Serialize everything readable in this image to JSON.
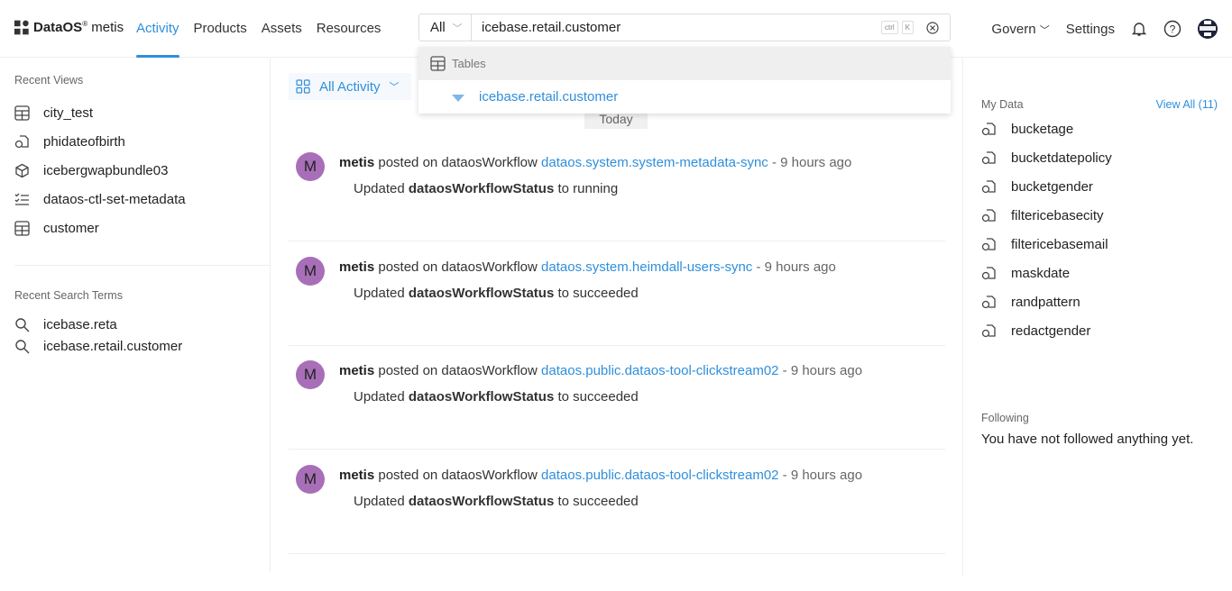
{
  "header": {
    "logo_brand": "DataOS",
    "logo_product": "metis",
    "nav": [
      {
        "label": "Activity",
        "active": true
      },
      {
        "label": "Products"
      },
      {
        "label": "Assets"
      },
      {
        "label": "Resources"
      }
    ],
    "search": {
      "scope": "All",
      "value": "icebase.retail.customer",
      "shortcut": [
        "ctrl",
        "K"
      ]
    },
    "right": {
      "govern": "Govern",
      "settings": "Settings"
    }
  },
  "dropdown": {
    "group": "Tables",
    "items": [
      {
        "label": "icebase.retail.customer"
      }
    ]
  },
  "sidebar": {
    "recent_views_title": "Recent Views",
    "recent_views": [
      {
        "label": "city_test",
        "icon": "table-icon"
      },
      {
        "label": "phidateofbirth",
        "icon": "policy-icon"
      },
      {
        "label": "icebergwapbundle03",
        "icon": "cube-icon"
      },
      {
        "label": "dataos-ctl-set-metadata",
        "icon": "checklist-icon"
      },
      {
        "label": "customer",
        "icon": "table-icon"
      }
    ],
    "recent_search_title": "Recent Search Terms",
    "recent_searches": [
      "icebase.reta",
      "icebase.retail.customer"
    ]
  },
  "main": {
    "filter": "All Activity",
    "day": "Today",
    "activities": [
      {
        "avatar": "M",
        "user": "metis",
        "verb": "posted on dataosWorkflow",
        "target": "dataos.system.system-metadata-sync",
        "time": "- 9 hours ago",
        "pre": "Updated",
        "field": "dataosWorkflowStatus",
        "post": "to running"
      },
      {
        "avatar": "M",
        "user": "metis",
        "verb": "posted on dataosWorkflow",
        "target": "dataos.system.heimdall-users-sync",
        "time": "- 9 hours ago",
        "pre": "Updated",
        "field": "dataosWorkflowStatus",
        "post": "to succeeded"
      },
      {
        "avatar": "M",
        "user": "metis",
        "verb": "posted on dataosWorkflow",
        "target": "dataos.public.dataos-tool-clickstream02",
        "time": "- 9 hours ago",
        "pre": "Updated",
        "field": "dataosWorkflowStatus",
        "post": "to succeeded"
      },
      {
        "avatar": "M",
        "user": "metis",
        "verb": "posted on dataosWorkflow",
        "target": "dataos.public.dataos-tool-clickstream02",
        "time": "- 9 hours ago",
        "pre": "Updated",
        "field": "dataosWorkflowStatus",
        "post": "to succeeded"
      }
    ]
  },
  "right_panel": {
    "my_data_title": "My Data",
    "view_all": "View All (11)",
    "my_data": [
      "bucketage",
      "bucketdatepolicy",
      "bucketgender",
      "filtericebasecity",
      "filtericebasemail",
      "maskdate",
      "randpattern",
      "redactgender"
    ],
    "following_title": "Following",
    "following_empty": "You have not followed anything yet."
  },
  "colors": {
    "accent": "#2f8fdc",
    "avatar": "#a86fb8"
  }
}
